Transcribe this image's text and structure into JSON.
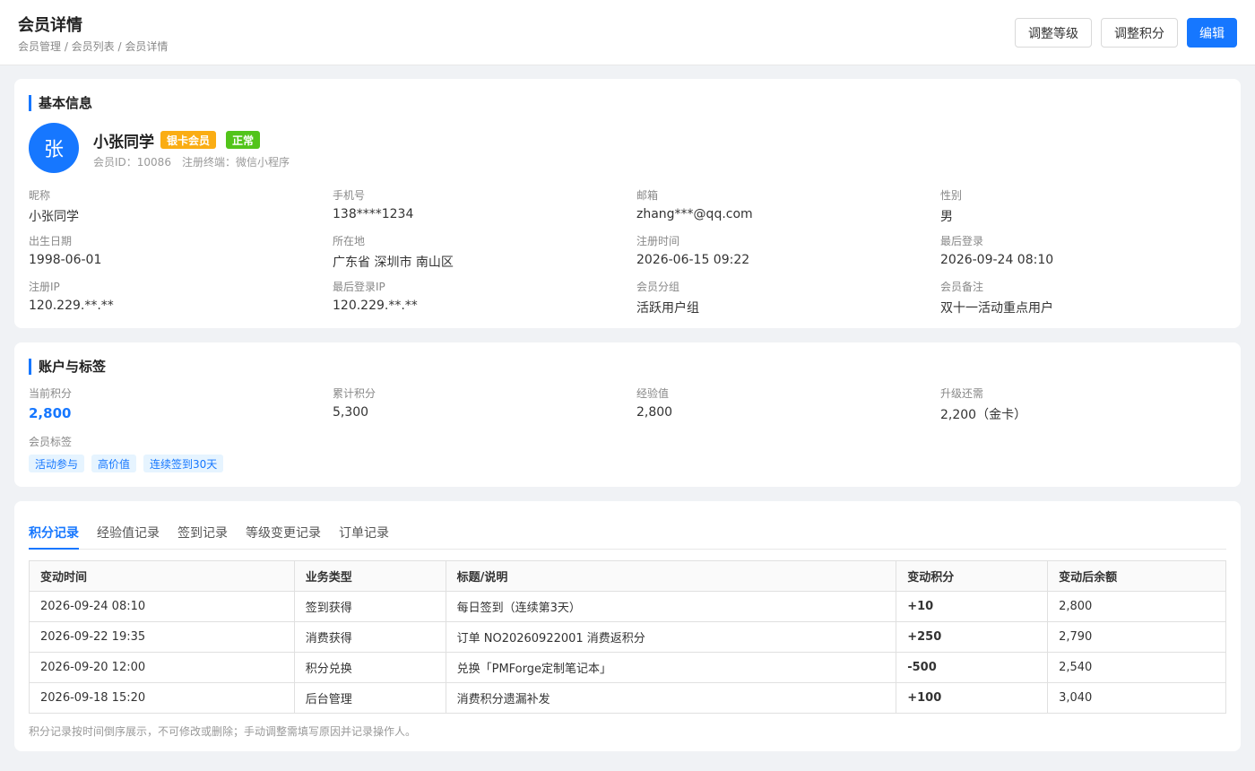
{
  "header": {
    "title": "会员详情",
    "breadcrumb": "会员管理 / 会员列表 / 会员详情",
    "buttons": {
      "adjust_level": "调整等级",
      "adjust_points": "调整积分",
      "edit": "编辑"
    }
  },
  "basic": {
    "section_title": "基本信息",
    "avatar_char": "张",
    "name": "小张同学",
    "level_badge": "银卡会员",
    "status_badge": "正常",
    "member_id": "会员ID：10086",
    "register_terminal": "注册终端：微信小程序",
    "colors": {
      "accent": "#1677ff",
      "level": "#faad14",
      "status": "#52c41a"
    },
    "fields": [
      {
        "label": "昵称",
        "value": "小张同学"
      },
      {
        "label": "手机号",
        "value": "138****1234"
      },
      {
        "label": "邮箱",
        "value": "zhang***@qq.com"
      },
      {
        "label": "性别",
        "value": "男"
      },
      {
        "label": "出生日期",
        "value": "1998-06-01"
      },
      {
        "label": "所在地",
        "value": "广东省 深圳市 南山区"
      },
      {
        "label": "注册时间",
        "value": "2026-06-15 09:22"
      },
      {
        "label": "最后登录",
        "value": "2026-09-24 08:10"
      },
      {
        "label": "注册IP",
        "value": "120.229.**.**"
      },
      {
        "label": "最后登录IP",
        "value": "120.229.**.**"
      },
      {
        "label": "会员分组",
        "value": "活跃用户组"
      },
      {
        "label": "会员备注",
        "value": "双十一活动重点用户"
      }
    ]
  },
  "account": {
    "section_title": "账户与标签",
    "fields": [
      {
        "label": "当前积分",
        "value": "2,800"
      },
      {
        "label": "累计积分",
        "value": "5,300"
      },
      {
        "label": "经验值",
        "value": "2,800"
      },
      {
        "label": "升级还需",
        "value": "2,200（金卡）"
      }
    ],
    "tags_label": "会员标签",
    "tags": [
      "活动参与",
      "高价值",
      "连续签到30天"
    ]
  },
  "records": {
    "tabs": [
      "积分记录",
      "经验值记录",
      "签到记录",
      "等级变更记录",
      "订单记录"
    ],
    "active_tab": "积分记录",
    "columns": [
      "变动时间",
      "业务类型",
      "标题/说明",
      "变动积分",
      "变动后余额"
    ],
    "rows": [
      [
        "2026-09-24 08:10",
        "签到获得",
        "每日签到（连续第3天）",
        "+10",
        "2,800"
      ],
      [
        "2026-09-22 19:35",
        "消费获得",
        "订单 NO20260922001 消费返积分",
        "+250",
        "2,790"
      ],
      [
        "2026-09-20 12:00",
        "积分兑换",
        "兑换「PMForge定制笔记本」",
        "-500",
        "2,540"
      ],
      [
        "2026-09-18 15:20",
        "后台管理",
        "消费积分遗漏补发",
        "+100",
        "3,040"
      ]
    ],
    "footnote": "积分记录按时间倒序展示，不可修改或删除；手动调整需填写原因并记录操作人。"
  }
}
